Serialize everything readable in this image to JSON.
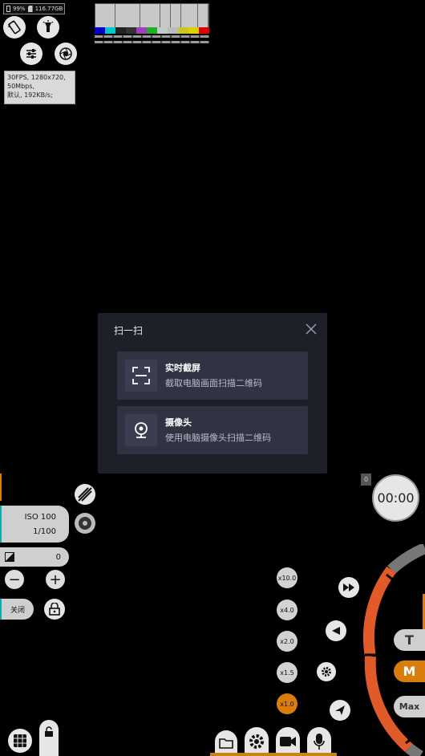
{
  "status": {
    "battery": "99%",
    "storage": "116.77GB"
  },
  "info": {
    "line1": "30FPS, 1280x720,",
    "line2": "50Mbps,",
    "line3": "默认, 192KB/s;"
  },
  "colors": {
    "accent": "#d97d0f",
    "ring": "#e05a2a",
    "dialog_bg": "#1d2029",
    "option_bg": "#303342"
  },
  "dialog": {
    "title": "扫一扫",
    "options": [
      {
        "title": "实时截屏",
        "desc": "截取电脑画面扫描二维码",
        "icon": "scan-frame-icon"
      },
      {
        "title": "摄像头",
        "desc": "使用电脑摄像头扫描二维码",
        "icon": "webcam-icon"
      }
    ]
  },
  "exposure": {
    "iso": "ISO 100",
    "shutter": "1/100",
    "ev": "0"
  },
  "controls": {
    "off_label": "关闭"
  },
  "zoom": {
    "levels": [
      "x10.0",
      "x4.0",
      "x2.0",
      "x1.5",
      "x1.0"
    ],
    "active": "x1.0"
  },
  "timer": {
    "value": "00:00",
    "counter": "0"
  },
  "modes": {
    "t": "T",
    "m": "M",
    "max": "Max",
    "active": "M"
  }
}
